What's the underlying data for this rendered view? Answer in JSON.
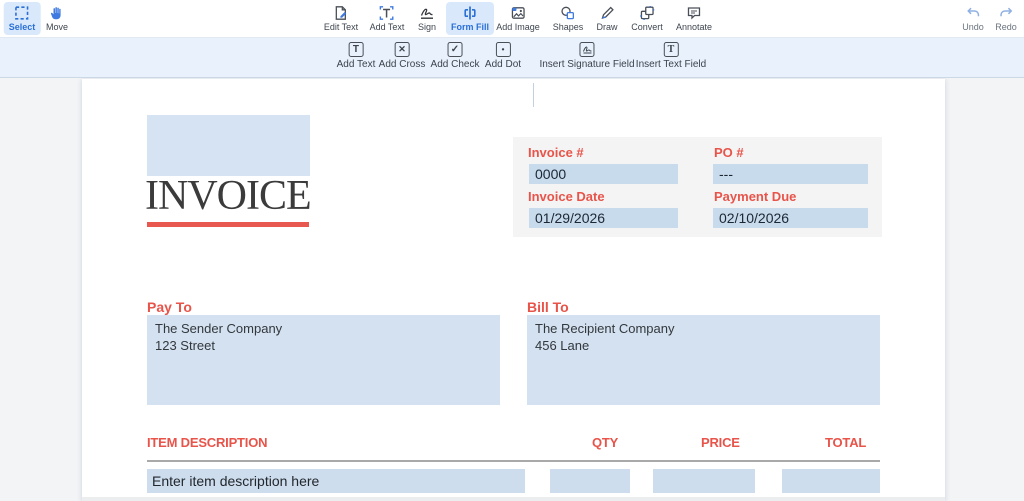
{
  "toolbar": {
    "left": [
      {
        "label": "Select",
        "icon": "select-icon",
        "active": true
      },
      {
        "label": "Move",
        "icon": "hand-icon",
        "active": false
      }
    ],
    "center": [
      {
        "label": "Edit Text",
        "icon": "edit-text-icon"
      },
      {
        "label": "Add Text",
        "icon": "add-text-icon"
      },
      {
        "label": "Sign",
        "icon": "signature-icon"
      },
      {
        "label": "Form Fill",
        "icon": "form-fill-icon",
        "active": true
      },
      {
        "label": "Add Image",
        "icon": "image-icon"
      },
      {
        "label": "Shapes",
        "icon": "shapes-icon"
      },
      {
        "label": "Draw",
        "icon": "pencil-icon"
      },
      {
        "label": "Convert",
        "icon": "convert-icon"
      },
      {
        "label": "Annotate",
        "icon": "speech-bubble-icon"
      }
    ],
    "right": [
      {
        "label": "Undo",
        "icon": "undo-icon"
      },
      {
        "label": "Redo",
        "icon": "redo-icon"
      }
    ]
  },
  "formfill_toolbar": {
    "items": [
      {
        "label": "Add Text",
        "icon": "boxed-t-icon",
        "glyph": "T"
      },
      {
        "label": "Add Cross",
        "icon": "boxed-cross-icon",
        "glyph": "✕"
      },
      {
        "label": "Add Check",
        "icon": "boxed-check-icon",
        "glyph": "✓"
      },
      {
        "label": "Add Dot",
        "icon": "boxed-dot-icon",
        "glyph": "•"
      }
    ],
    "field_items": [
      {
        "label": "Insert Signature Field",
        "icon": "signature-field-icon"
      },
      {
        "label": "Insert Text Field",
        "icon": "text-field-icon",
        "glyph": "T"
      }
    ]
  },
  "document": {
    "title": "INVOICE",
    "details": {
      "invoice_number": {
        "label": "Invoice #",
        "value": "0000"
      },
      "po_number": {
        "label": "PO #",
        "value": "---"
      },
      "invoice_date": {
        "label": "Invoice Date",
        "value": "01/29/2026"
      },
      "payment_due": {
        "label": "Payment Due",
        "value": "02/10/2026"
      }
    },
    "pay_to": {
      "label": "Pay To",
      "line1": "The Sender Company",
      "line2": "123 Street"
    },
    "bill_to": {
      "label": "Bill To",
      "line1": "The Recipient Company",
      "line2": "456 Lane"
    },
    "items_table": {
      "headers": {
        "description": "ITEM DESCRIPTION",
        "qty": "QTY",
        "price": "PRICE",
        "total": "TOTAL"
      },
      "row1": {
        "description": "Enter item description here",
        "qty": "",
        "price": "",
        "total": ""
      }
    }
  },
  "colors": {
    "accent_blue": "#2a6fd6",
    "active_button_bg": "#d9e9fb",
    "accent_red": "#e8544a",
    "field_blue": "#c8dbed",
    "panel_gray": "#f4f4f4",
    "subtoolbar_bg": "#e8f1fc"
  }
}
